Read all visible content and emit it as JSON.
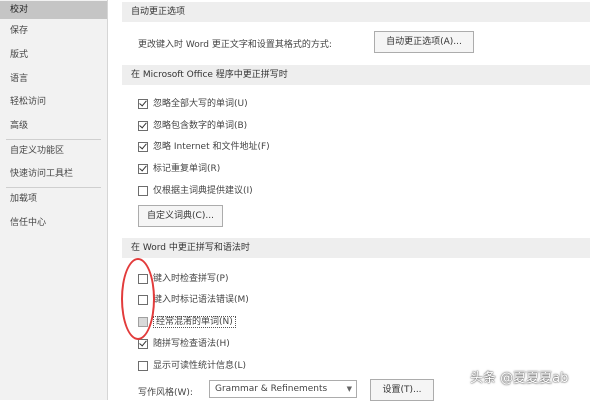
{
  "sidebar": {
    "items": [
      {
        "label": "校对",
        "selected": true
      },
      {
        "label": "保存"
      },
      {
        "label": "版式"
      },
      {
        "label": "语言"
      },
      {
        "label": "轻松访问"
      },
      {
        "label": "高级"
      },
      {
        "label": "自定义功能区"
      },
      {
        "label": "快速访问工具栏"
      },
      {
        "label": "加载项"
      },
      {
        "label": "信任中心"
      }
    ]
  },
  "autocorrect": {
    "header": "自动更正选项",
    "description": "更改键入时 Word 更正文字和设置其格式的方式:",
    "button_label": "自动更正选项(A)..."
  },
  "office_spelling": {
    "header": "在 Microsoft Office 程序中更正拼写时",
    "options": [
      {
        "label": "忽略全部大写的单词(U)",
        "checked": true
      },
      {
        "label": "忽略包含数字的单词(B)",
        "checked": true
      },
      {
        "label": "忽略 Internet 和文件地址(F)",
        "checked": true
      },
      {
        "label": "标记重复单词(R)",
        "checked": true
      },
      {
        "label": "仅根据主词典提供建议(I)",
        "checked": false
      }
    ],
    "custom_dict_button": "自定义词典(C)..."
  },
  "word_spelling": {
    "header": "在 Word 中更正拼写和语法时",
    "options": [
      {
        "label": "键入时检查拼写(P)",
        "checked": false
      },
      {
        "label": "键入时标记语法错误(M)",
        "checked": false
      },
      {
        "label": "经常混淆的单词(N)",
        "checked": false,
        "disabled": true
      },
      {
        "label": "随拼写检查语法(H)",
        "checked": true
      },
      {
        "label": "显示可读性统计信息(L)",
        "checked": false
      }
    ],
    "writing_style_label": "写作风格(W):",
    "writing_style_value": "Grammar & Refinements",
    "settings_button": "设置(T)..."
  },
  "colors": {
    "annotation": "#e23b3b",
    "sidebar_selected": "#c5c5c5"
  },
  "watermark": "头条 @夏夏夏ab"
}
